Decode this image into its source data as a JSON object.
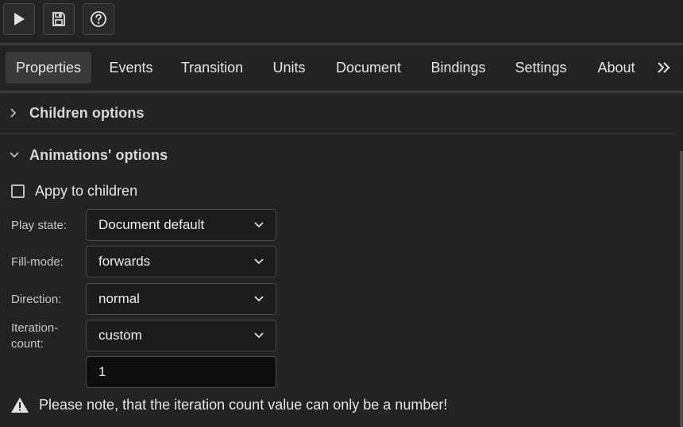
{
  "toolbar": {
    "buttons": [
      {
        "icon": "play-icon"
      },
      {
        "icon": "save-icon"
      },
      {
        "icon": "help-icon"
      }
    ]
  },
  "tabs": {
    "items": [
      {
        "label": "Properties",
        "active": true
      },
      {
        "label": "Events"
      },
      {
        "label": "Transition"
      },
      {
        "label": "Units"
      },
      {
        "label": "Document"
      },
      {
        "label": "Bindings"
      },
      {
        "label": "Settings"
      },
      {
        "label": "About"
      }
    ],
    "overflow_icon": "double-chevron-right-icon"
  },
  "sections": {
    "children": {
      "title": "Children options",
      "expanded": false
    },
    "animations": {
      "title": "Animations' options",
      "expanded": true
    }
  },
  "animations": {
    "apply_children_label": "Appy to children",
    "apply_children_checked": false,
    "play_state": {
      "label": "Play state:",
      "value": "Document default"
    },
    "fill_mode": {
      "label": "Fill-mode:",
      "value": "forwards"
    },
    "direction": {
      "label": "Direction:",
      "value": "normal"
    },
    "iteration_count": {
      "label_line1": "Iteration-",
      "label_line2": "count:",
      "value": "custom",
      "custom_value": "1"
    },
    "note": "Please note, that the iteration count value can only be a number!"
  },
  "colors": {
    "background": "#232323",
    "active_tab": "#3a3a3a",
    "border": "#4a4a4a",
    "text": "#e6e6e6"
  }
}
